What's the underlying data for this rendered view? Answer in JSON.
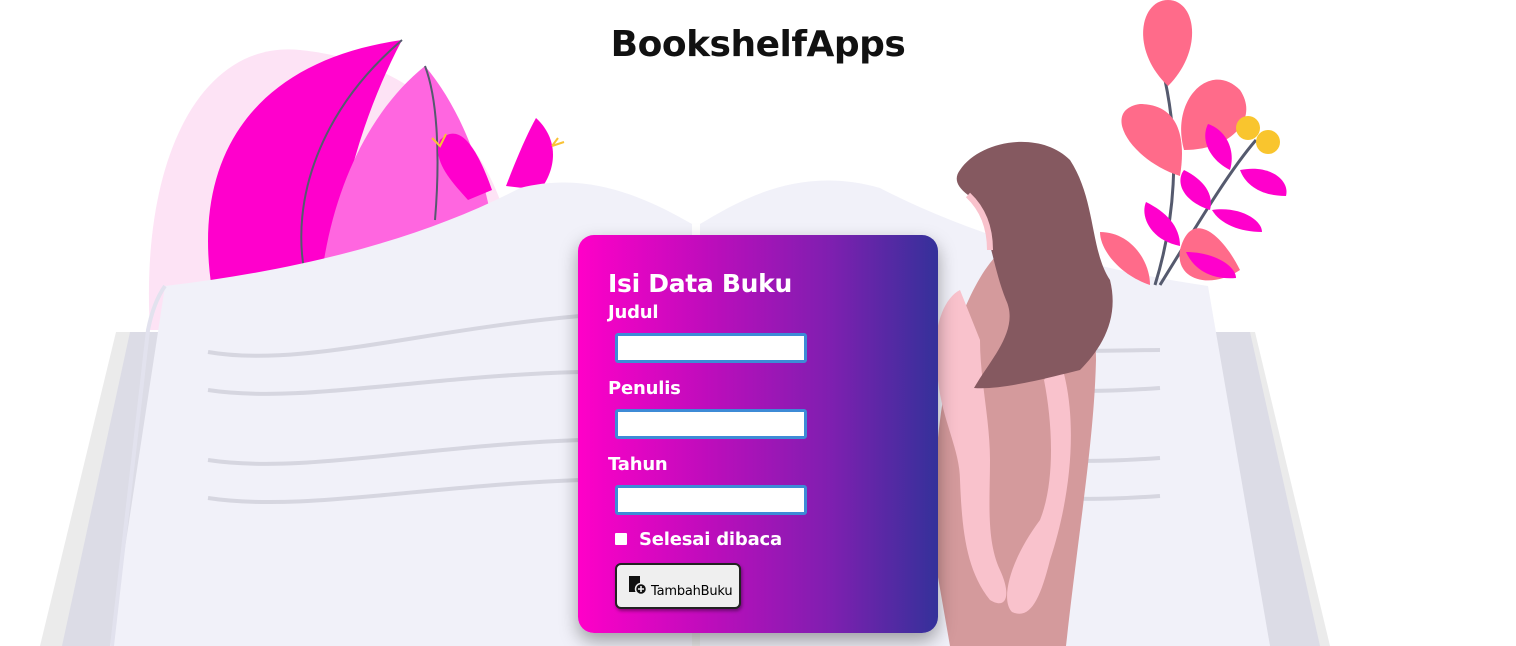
{
  "app": {
    "title": "BookshelfApps"
  },
  "form": {
    "heading": "Isi Data Buku",
    "fields": [
      {
        "label": "Judul",
        "value": "",
        "placeholder": ""
      },
      {
        "label": "Penulis",
        "value": "",
        "placeholder": ""
      },
      {
        "label": "Tahun",
        "value": "",
        "placeholder": ""
      }
    ],
    "checkbox": {
      "label": "Selesai dibaca",
      "checked": false
    },
    "submit": {
      "label": "TambahBuku",
      "icon": "add-book-icon"
    }
  },
  "colors": {
    "card_gradient_start": "#ff00c8",
    "card_gradient_end": "#34319a",
    "input_border": "#3d8bd6",
    "illustration_magenta": "#ff00cc",
    "illustration_pink": "#ff6b8a"
  }
}
